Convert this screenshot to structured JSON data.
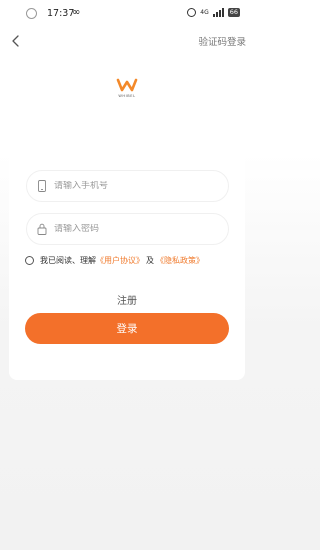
{
  "status_bar": {
    "time": "17:37",
    "indicator": "∞",
    "network": "4G",
    "battery": "66"
  },
  "header": {
    "verify_code_login": "验证码登录"
  },
  "logo": {
    "text": "WHIBEL"
  },
  "form": {
    "phone_placeholder": "请输入手机号",
    "password_placeholder": "请输入密码",
    "agree_prefix": "我已阅读、理解",
    "user_agreement": "《用户协议》",
    "and": "及",
    "privacy_policy": "《隐私政策》",
    "register_label": "注册",
    "login_label": "登录"
  },
  "colors": {
    "accent": "#f3702a",
    "link": "#f07a2c"
  }
}
